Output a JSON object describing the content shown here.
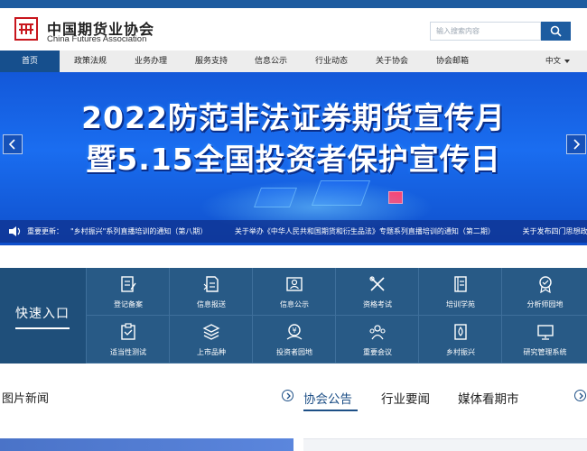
{
  "header": {
    "title": "中国期货业协会",
    "subtitle": "China Futures Association",
    "search_placeholder": "输入搜索内容"
  },
  "nav": {
    "items": [
      "首页",
      "政策法规",
      "业务办理",
      "服务支持",
      "信息公示",
      "行业动态",
      "关于协会",
      "协会邮箱"
    ],
    "active": "首页",
    "language": "中文"
  },
  "banner": {
    "line1": "2022防范非法证券期货宣传月",
    "line2": "暨5.15全国投资者保护宣传日"
  },
  "ticker": {
    "label": "重要更新：",
    "items": [
      "\"乡村振兴\"系列直播培训的通知（第八期）",
      "关于举办《中华人民共和国期货和衍生品法》专题系列直播培训的通知（第二期）",
      "关于发布四门思想政治"
    ]
  },
  "quick_entry": {
    "title": "快速入口",
    "items": [
      {
        "label": "登记备案",
        "icon": "register-icon"
      },
      {
        "label": "信息报送",
        "icon": "report-icon"
      },
      {
        "label": "信息公示",
        "icon": "publicity-icon"
      },
      {
        "label": "资格考试",
        "icon": "exam-icon"
      },
      {
        "label": "培训学苑",
        "icon": "training-icon"
      },
      {
        "label": "分析师园地",
        "icon": "analyst-icon"
      },
      {
        "label": "适当性测试",
        "icon": "checklist-icon"
      },
      {
        "label": "上市品种",
        "icon": "layers-icon"
      },
      {
        "label": "投资者园地",
        "icon": "investor-icon"
      },
      {
        "label": "重要会议",
        "icon": "meeting-icon"
      },
      {
        "label": "乡村振兴",
        "icon": "rural-icon"
      },
      {
        "label": "研究管理系统",
        "icon": "monitor-icon"
      }
    ]
  },
  "sections": {
    "left_title": "图片新闻",
    "tabs": [
      "协会公告",
      "行业要闻",
      "媒体看期市"
    ],
    "active_tab": "协会公告"
  },
  "colors": {
    "brand_blue": "#1d5ca0",
    "nav_active": "#164f8d",
    "logo_red": "#c8161d",
    "quick_bg": "#285a86"
  }
}
